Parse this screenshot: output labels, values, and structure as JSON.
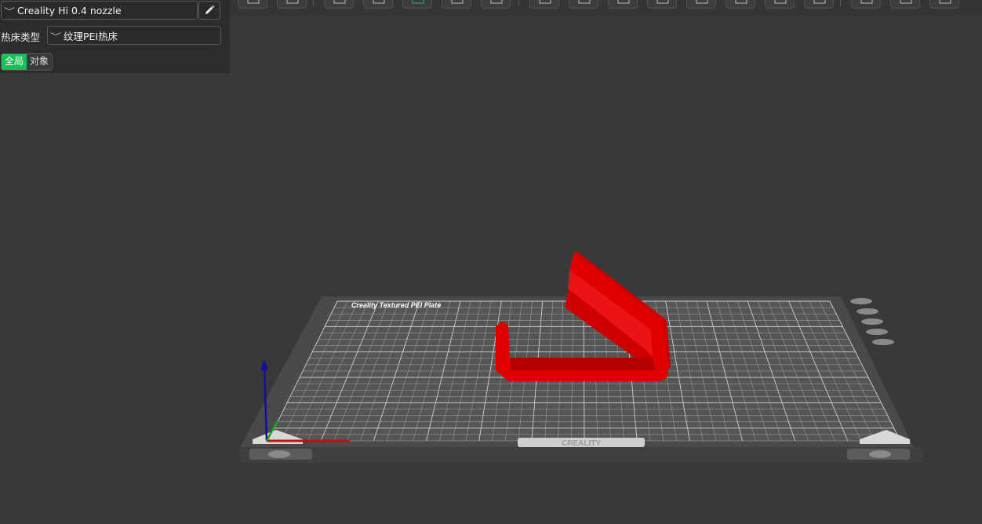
{
  "printer": {
    "name": "Creality Hi 0.4 nozzle",
    "chevron": "chevron-down-icon",
    "edit_icon": "pencil-icon"
  },
  "bed": {
    "label": "热床类型",
    "value": "纹理PEI热床",
    "chevron": "chevron-down-icon"
  },
  "mode_toggle": {
    "global_label": "全局",
    "object_label": "对象",
    "active": "global"
  },
  "plate": {
    "title_text": "Creality Textured PEI Plate",
    "brand_text": "CREALITY"
  },
  "toolbar": {
    "icons": [
      "add-object-icon",
      "add-plate-icon",
      "orient-icon",
      "auto-orient-icon",
      "arrange-icon",
      "split-objects-icon",
      "layers-icon",
      "move-icon",
      "rotate-icon",
      "scale-icon",
      "cut-icon",
      "support-paint-icon",
      "seam-paint-icon",
      "color-paint-icon",
      "measure-icon",
      "assembly-icon",
      "text-icon",
      "emboss-icon"
    ]
  },
  "colors": {
    "accent": "#17c15a",
    "model": "#e00000",
    "background": "#393939",
    "plate": "#4b4b4b"
  }
}
